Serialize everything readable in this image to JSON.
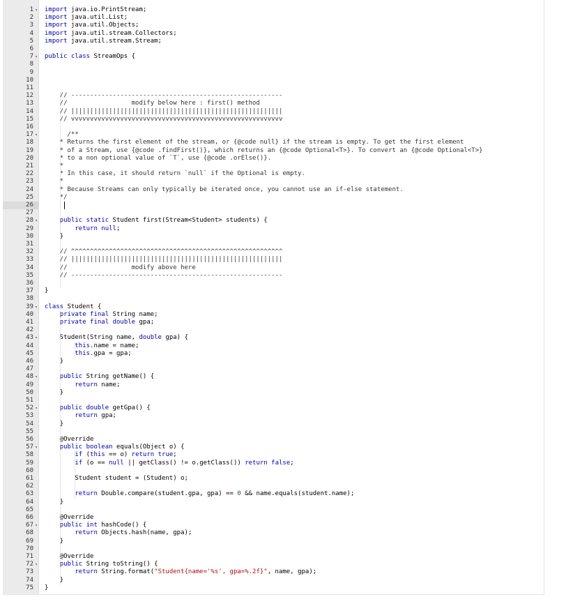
{
  "editor": {
    "theme_colors": {
      "gutter_bg": "#ebebeb",
      "keyword": "#0000aa",
      "text": "#000000"
    },
    "fold_marker_icon": "caret-down-icon",
    "lines": [
      "import java.io.PrintStream;",
      "import java.util.List;",
      "import java.util.Objects;",
      "import java.util.stream.Collectors;",
      "import java.util.stream.Stream;",
      "",
      "public class StreamOps {",
      "",
      "",
      "",
      "",
      "    // --------------------------------------------------------",
      "    //                 modify below here : first() method",
      "    // ||||||||||||||||||||||||||||||||||||||||||||||||||||||||",
      "    // vvvvvvvvvvvvvvvvvvvvvvvvvvvvvvvvvvvvvvvvvvvvvvvvvvvvvvvv",
      "",
      "      /**",
      "    * Returns the first element of the stream, or {@code null} if the stream is empty. To get the first element",
      "    * of a Stream, use {@code .findFirst()}, which returns an {@code Optional<T>}. To convert an {@code Optional<T>}",
      "    * to a non optional value of `T`, use {@code .orElse()}.",
      "    *",
      "    * In this case, it should return `null` if the Optional is empty.",
      "    *",
      "    * Because Streams can only typically be iterated once, you cannot use an if-else statement.",
      "    */",
      "",
      "",
      "    public static Student first(Stream<Student> students) {",
      "        return null;",
      "    }",
      "",
      "    // ^^^^^^^^^^^^^^^^^^^^^^^^^^^^^^^^^^^^^^^^^^^^^^^^^^^^^^^^",
      "    // ||||||||||||||||||||||||||||||||||||||||||||||||||||||||",
      "    //                 modify above here",
      "    // --------------------------------------------------------",
      "",
      "}",
      "",
      "class Student {",
      "    private final String name;",
      "    private final double gpa;",
      "",
      "    Student(String name, double gpa) {",
      "        this.name = name;",
      "        this.gpa = gpa;",
      "    }",
      "",
      "    public String getName() {",
      "        return name;",
      "    }",
      "",
      "    public double getGpa() {",
      "        return gpa;",
      "    }",
      "",
      "    @Override",
      "    public boolean equals(Object o) {",
      "        if (this == o) return true;",
      "        if (o == null || getClass() != o.getClass()) return false;",
      "",
      "        Student student = (Student) o;",
      "",
      "        return Double.compare(student.gpa, gpa) == 0 && name.equals(student.name);",
      "    }",
      "",
      "    @Override",
      "    public int hashCode() {",
      "        return Objects.hash(name, gpa);",
      "    }",
      "",
      "    @Override",
      "    public String toString() {",
      "        return String.format(\"Student{name='%s', gpa=%.2f}\", name, gpa);",
      "    }",
      "}"
    ],
    "fold_lines": [
      1,
      7,
      17,
      28,
      39,
      43,
      48,
      52,
      57,
      67,
      72
    ],
    "active_line": 26
  }
}
